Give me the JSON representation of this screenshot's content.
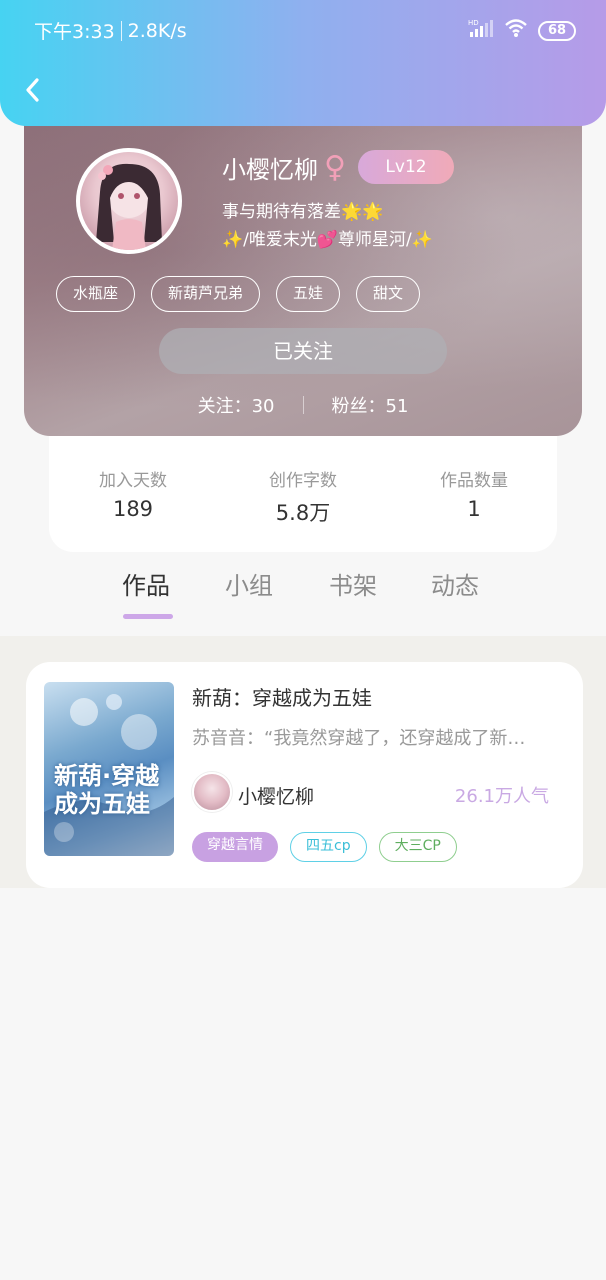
{
  "status_bar": {
    "time": "下午3:33",
    "speed": "2.8K/s",
    "network": "HD",
    "battery": "68"
  },
  "profile": {
    "username": "小樱忆柳",
    "gender_symbol": "♀",
    "level": "Lv12",
    "bio_line1": "事与期待有落差🌟🌟",
    "bio_line2": "✨/唯爱末光💕尊师星河/✨",
    "tags": [
      "水瓶座",
      "新葫芦兄弟",
      "五娃",
      "甜文"
    ],
    "follow_button": "已关注",
    "following_label": "关注：30",
    "fans_label": "粉丝：51"
  },
  "stats": [
    {
      "label": "加入天数",
      "value": "189"
    },
    {
      "label": "创作字数",
      "value": "5.8万"
    },
    {
      "label": "作品数量",
      "value": "1"
    }
  ],
  "tabs": [
    {
      "label": "作品",
      "active": true
    },
    {
      "label": "小组",
      "active": false
    },
    {
      "label": "书架",
      "active": false
    },
    {
      "label": "动态",
      "active": false
    }
  ],
  "book": {
    "title": "新葫：穿越成为五娃",
    "excerpt": "苏音音：“我竟然穿越了，还穿越成了新…",
    "author": "小樱忆柳",
    "popularity": "26.1万人气",
    "cover_text": "新葫·穿越成为五娃",
    "genre_tags": [
      "穿越言情",
      "四五cp",
      "大三CP"
    ]
  },
  "colors": {
    "header_gradient_start": "#46d3f2",
    "header_gradient_end": "#b69be8",
    "tab_underline": "#cda7e8",
    "popularity": "#c9a9e3"
  }
}
